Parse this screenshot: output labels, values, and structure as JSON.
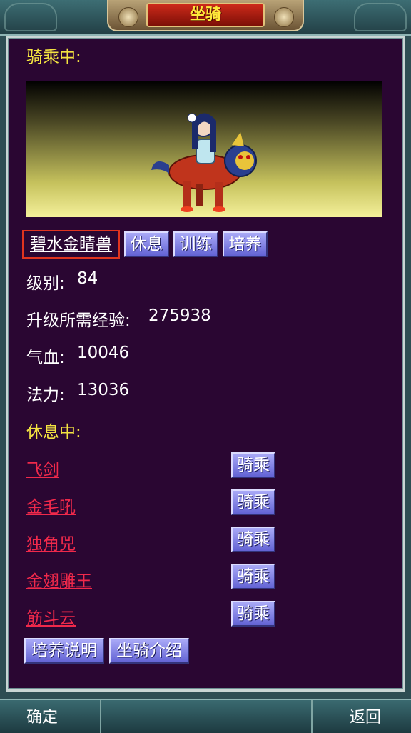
{
  "header": {
    "title": "坐骑"
  },
  "riding": {
    "section_label": "骑乘中:",
    "mount_name": "碧水金睛兽",
    "actions": [
      "休息",
      "训练",
      "培养"
    ],
    "stats": [
      {
        "label": "级别:",
        "value": "84"
      },
      {
        "label": "升级所需经验:",
        "value": "275938"
      },
      {
        "label": "气血:",
        "value": "10046"
      },
      {
        "label": "法力:",
        "value": "13036"
      }
    ]
  },
  "resting": {
    "section_label": "休息中:",
    "ride_label": "骑乘",
    "mounts": [
      "飞剑",
      "金毛吼",
      "独角兕",
      "金翅雕王",
      "筋斗云"
    ]
  },
  "footer_buttons": [
    "培养说明",
    "坐骑介绍"
  ],
  "bottom": {
    "confirm": "确定",
    "back": "返回"
  }
}
